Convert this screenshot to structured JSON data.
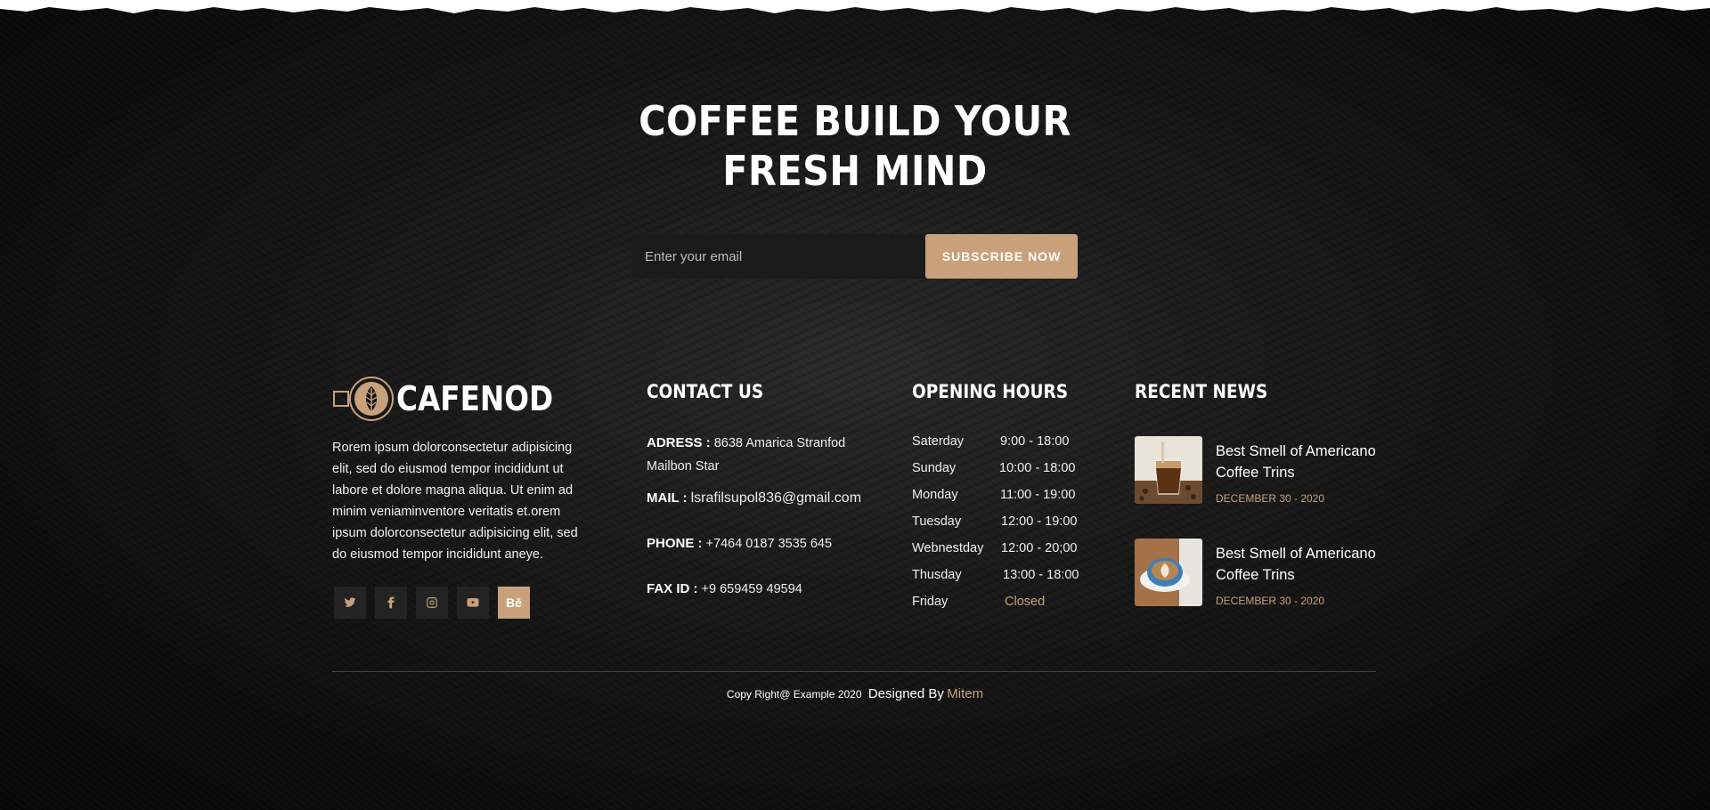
{
  "subscribe": {
    "headline_line1": "COFFEE BUILD YOUR",
    "headline_line2": "FRESH MIND",
    "email_placeholder": "Enter your email",
    "button_label": "SUBSCRIBE NOW"
  },
  "brand": {
    "name": "CAFENOD",
    "about": "Rorem ipsum dolorconsectetur adipisicing elit, sed do eiusmod tempor incididunt ut labore et dolore magna aliqua. Ut enim ad minim veniaminventore veritatis et.orem ipsum dolorconsectetur adipisicing elit, sed do eiusmod tempor incididunt aneye.",
    "socials": [
      {
        "icon": "twitter-icon",
        "glyph": ""
      },
      {
        "icon": "facebook-icon",
        "glyph": ""
      },
      {
        "icon": "instagram-icon",
        "glyph": ""
      },
      {
        "icon": "youtube-icon",
        "glyph": ""
      },
      {
        "icon": "behance-icon",
        "glyph": "Bē"
      }
    ]
  },
  "contact": {
    "title": "CONTACT US",
    "address_label": "ADRESS :",
    "address_value": "8638 Amarica Stranfod Mailbon Star",
    "mail_label": "MAIL :",
    "mail_value": "lsrafilsupol836@gmail.com",
    "phone_label": "PHONE :",
    "phone_value": "+7464 0187 3535 645",
    "fax_label": "FAX ID :",
    "fax_value": "+9 659459 49594"
  },
  "hours": {
    "title": "OPENING HOURS",
    "rows": [
      {
        "day": "Saterday",
        "time": "9:00 - 18:00"
      },
      {
        "day": "Sunday",
        "time": "10:00 - 18:00"
      },
      {
        "day": "Monday",
        "time": "11:00 - 19:00"
      },
      {
        "day": "Tuesday",
        "time": "12:00 - 19:00"
      },
      {
        "day": "Webnestday",
        "time": "12:00 - 20;00"
      },
      {
        "day": "Thusday",
        "time": "13:00 - 18:00"
      },
      {
        "day": "Friday",
        "time": "Closed"
      }
    ]
  },
  "news": {
    "title": "RECENT NEWS",
    "items": [
      {
        "title": "Best Smell of Americano Coffee Trins",
        "date": "DECEMBER 30 - 2020"
      },
      {
        "title": "Best Smell of Americano Coffee Trins",
        "date": "DECEMBER 30 - 2020"
      }
    ]
  },
  "footer": {
    "copyright": "Copy Right@ Example 2020",
    "designed_by": "Designed By",
    "author": "Mitem"
  },
  "colors": {
    "accent": "#c8a17a",
    "background": "#111111"
  }
}
